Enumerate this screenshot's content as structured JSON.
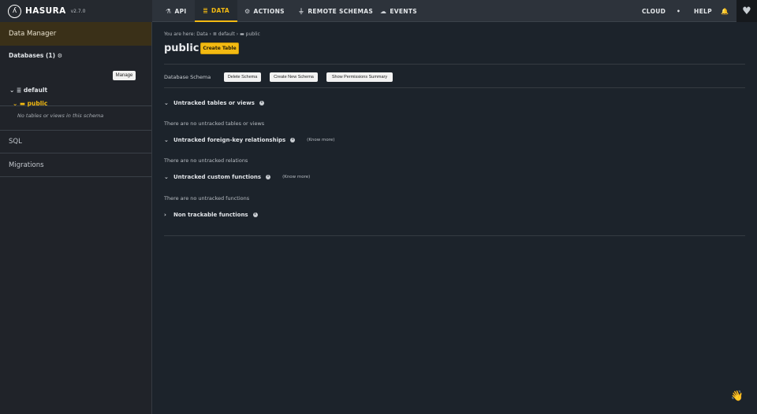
{
  "brand": {
    "name": "HASURA",
    "version": "v2.7.0"
  },
  "topnav": {
    "items": [
      {
        "icon": "⚗",
        "label": "API"
      },
      {
        "icon": "≣",
        "label": "DATA"
      },
      {
        "icon": "⚙",
        "label": "ACTIONS"
      },
      {
        "icon": "⏚",
        "label": "REMOTE SCHEMAS"
      },
      {
        "icon": "☁",
        "label": "EVENTS"
      }
    ],
    "cloud": "CLOUD",
    "settings_icon": "•",
    "help": "HELP",
    "bell_icon": "🔔",
    "heart_icon": "♥"
  },
  "sidebar": {
    "title": "Data Manager",
    "databases_label": "Databases (1)",
    "manage": "Manage",
    "db_name": "default",
    "schema_name": "public",
    "empty_text": "No tables or views in this schema",
    "links": [
      "SQL",
      "Migrations"
    ]
  },
  "main": {
    "breadcrumb": "You are here: Data › ≣ default › ▬ public",
    "title": "public",
    "create_table": "Create Table",
    "schema_label": "Database Schema",
    "buttons": [
      "Delete Schema",
      "Create New Schema",
      "Show Permissions Summary"
    ],
    "sections": [
      {
        "title": "Untracked tables or views",
        "message": "There are no untracked tables or views"
      },
      {
        "title": "Untracked foreign-key relationships",
        "know_more": "(Know more)",
        "message": "There are no untracked relations"
      },
      {
        "title": "Untracked custom functions",
        "know_more": "(Know more)",
        "message": "There are no untracked functions"
      },
      {
        "title": "Non trackable functions"
      }
    ]
  },
  "colors": {
    "accent": "#f3ba12",
    "background": "#1c232b",
    "topbar": "#2d333b",
    "sidebar": "#202329"
  }
}
